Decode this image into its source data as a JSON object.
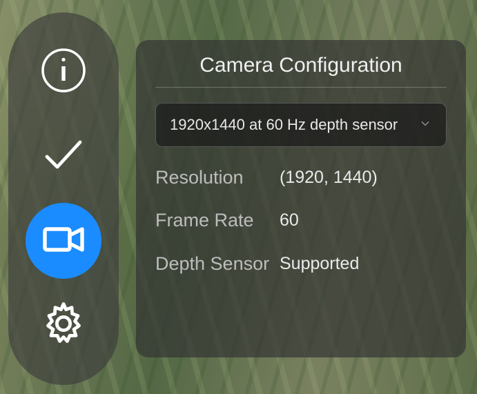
{
  "sidebar": {
    "items": [
      {
        "name": "info",
        "active": false
      },
      {
        "name": "check",
        "active": false
      },
      {
        "name": "camera",
        "active": true
      },
      {
        "name": "settings",
        "active": false
      }
    ]
  },
  "panel": {
    "title": "Camera Configuration",
    "dropdown": {
      "selected": "1920x1440 at 60 Hz depth sensor"
    },
    "rows": [
      {
        "label": "Resolution",
        "value": "(1920, 1440)"
      },
      {
        "label": "Frame Rate",
        "value": "60"
      },
      {
        "label": "Depth Sensor",
        "value": "Supported"
      }
    ]
  }
}
